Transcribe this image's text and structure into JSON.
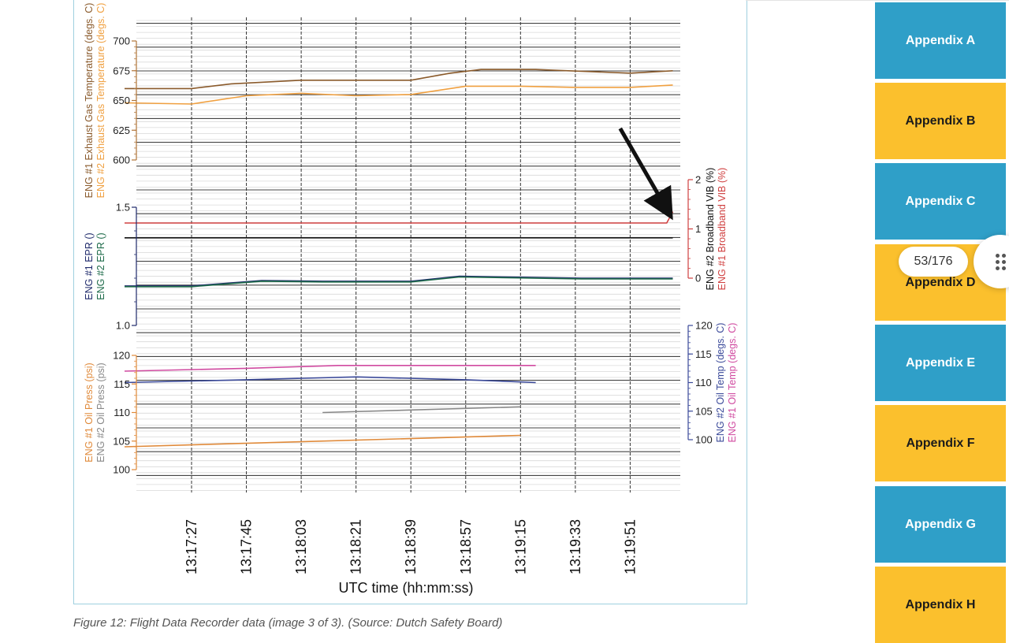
{
  "caption": "Figure 12: Flight Data Recorder data (image 3 of 3). (Source: Dutch Safety Board)",
  "page_indicator": "53/176",
  "sidebar": {
    "items": [
      {
        "label": "Appendix A",
        "style": "blue"
      },
      {
        "label": "Appendix B",
        "style": "yellow"
      },
      {
        "label": "Appendix C",
        "style": "blue"
      },
      {
        "label": "Appendix D",
        "style": "yellow"
      },
      {
        "label": "Appendix E",
        "style": "blue"
      },
      {
        "label": "Appendix F",
        "style": "yellow"
      },
      {
        "label": "Appendix G",
        "style": "blue"
      },
      {
        "label": "Appendix H",
        "style": "yellow"
      }
    ]
  },
  "colors": {
    "accent_blue": "#2f9fc8",
    "accent_yellow": "#fbc02d",
    "eng1_egt": "#8a5a2b",
    "eng2_egt": "#f0a040",
    "eng1_epr": "#1f2a6b",
    "eng2_epr": "#1e6b4a",
    "eng2_vib": "#111111",
    "eng1_vib": "#d04040",
    "eng1_oilpress": "#e08a3a",
    "eng2_oilpress": "#888888",
    "eng2_oiltemp": "#3b4a9a",
    "eng1_oiltemp": "#d04aa0"
  },
  "chart_data": {
    "type": "line",
    "xlabel": "UTC time (hh:mm:ss)",
    "x_ticks": [
      "13:17:27",
      "13:17:45",
      "13:18:03",
      "13:18:21",
      "13:18:39",
      "13:18:57",
      "13:19:15",
      "13:19:33",
      "13:19:51"
    ],
    "grid": true,
    "panels": [
      {
        "id": "egt",
        "ylabels": [
          "ENG #1 Exhaust Gas Temperature (degs. C)",
          "ENG #2 Exhaust Gas Temperature (degs. C)"
        ],
        "ylim": [
          600,
          700
        ],
        "y_ticks": [
          "600",
          "625",
          "650",
          "675",
          "700"
        ],
        "series": [
          {
            "name": "ENG #1 Exhaust Gas Temperature",
            "color_key": "eng1_egt",
            "x": [
              "13:17:05",
              "13:17:27",
              "13:17:40",
              "13:18:03",
              "13:18:25",
              "13:18:39",
              "13:18:52",
              "13:19:02",
              "13:19:20",
              "13:19:51",
              "13:20:05"
            ],
            "y": [
              660,
              660,
              664,
              667,
              667,
              667,
              673,
              676,
              676,
              673,
              675
            ]
          },
          {
            "name": "ENG #2 Exhaust Gas Temperature",
            "color_key": "eng2_egt",
            "x": [
              "13:17:05",
              "13:17:27",
              "13:17:45",
              "13:18:03",
              "13:18:21",
              "13:18:39",
              "13:18:57",
              "13:19:15",
              "13:19:33",
              "13:19:51",
              "13:20:05"
            ],
            "y": [
              648,
              647,
              654,
              656,
              654,
              655,
              662,
              662,
              661,
              661,
              663
            ]
          }
        ]
      },
      {
        "id": "epr",
        "ylabels": [
          "ENG #1 EPR ()",
          "ENG #2 EPR ()"
        ],
        "ylim": [
          1.0,
          1.5
        ],
        "y_ticks": [
          "1.0",
          "1.5"
        ],
        "series": [
          {
            "name": "ENG #1 EPR",
            "color_key": "eng1_epr",
            "x": [
              "13:17:05",
              "13:17:27",
              "13:17:50",
              "13:18:10",
              "13:18:39",
              "13:18:55",
              "13:19:15",
              "13:19:35",
              "13:20:05"
            ],
            "y": [
              1.167,
              1.167,
              1.19,
              1.187,
              1.187,
              1.208,
              1.204,
              1.2,
              1.2
            ]
          },
          {
            "name": "ENG #2 EPR",
            "color_key": "eng2_epr",
            "x": [
              "13:17:05",
              "13:17:27",
              "13:17:50",
              "13:18:10",
              "13:18:39",
              "13:18:55",
              "13:19:15",
              "13:19:35",
              "13:20:05"
            ],
            "y": [
              1.164,
              1.164,
              1.187,
              1.184,
              1.184,
              1.205,
              1.201,
              1.197,
              1.197
            ]
          }
        ]
      },
      {
        "id": "vib",
        "ylabels": [
          "ENG #2 Broadband VIB (%)",
          "ENG #1 Broadband VIB (%)"
        ],
        "ylim": [
          0,
          2
        ],
        "y_ticks": [
          "0",
          "1",
          "2"
        ],
        "series": [
          {
            "name": "ENG #2 Broadband VIB",
            "color_key": "eng2_vib",
            "x": [
              "13:17:05",
              "13:20:05"
            ],
            "y": [
              0.82,
              0.82
            ]
          },
          {
            "name": "ENG #1 Broadband VIB",
            "color_key": "eng1_vib",
            "x": [
              "13:17:05",
              "13:19:30",
              "13:20:03",
              "13:20:05"
            ],
            "y": [
              1.12,
              1.12,
              1.12,
              1.35
            ]
          }
        ]
      },
      {
        "id": "oilpress",
        "ylabels": [
          "ENG #1 Oil Press (psi)",
          "ENG #2 Oil Press (psi)"
        ],
        "ylim": [
          100,
          120
        ],
        "y_ticks": [
          "100",
          "105",
          "110",
          "115",
          "120"
        ],
        "series": [
          {
            "name": "ENG #1 Oil Press",
            "color_key": "eng1_oilpress",
            "x": [
              "13:17:05",
              "13:19:15"
            ],
            "y": [
              104.0,
              106.0
            ]
          },
          {
            "name": "ENG #2 Oil Press",
            "color_key": "eng2_oilpress",
            "x": [
              "13:18:10",
              "13:19:15"
            ],
            "y": [
              110.0,
              111.0
            ]
          }
        ]
      },
      {
        "id": "oiltemp",
        "ylabels": [
          "ENG #2 Oil Temp (degs. C)",
          "ENG #1 Oil Temp (degs. C)"
        ],
        "ylim": [
          100,
          120
        ],
        "y_ticks": [
          "100",
          "105",
          "110",
          "115",
          "120"
        ],
        "series": [
          {
            "name": "ENG #2 Oil Temp",
            "color_key": "eng2_oiltemp",
            "x": [
              "13:17:05",
              "13:17:45",
              "13:18:21",
              "13:18:57",
              "13:19:20"
            ],
            "y": [
              110,
              110.5,
              111,
              110.5,
              110
            ]
          },
          {
            "name": "ENG #1 Oil Temp",
            "color_key": "eng1_oiltemp",
            "x": [
              "13:17:05",
              "13:17:45",
              "13:18:15",
              "13:19:20"
            ],
            "y": [
              112,
              112.5,
              113,
              113
            ]
          }
        ]
      }
    ],
    "annotations": [
      {
        "type": "arrow",
        "points_to": "ENG #1 Broadband VIB",
        "x": "13:20:03"
      }
    ]
  }
}
